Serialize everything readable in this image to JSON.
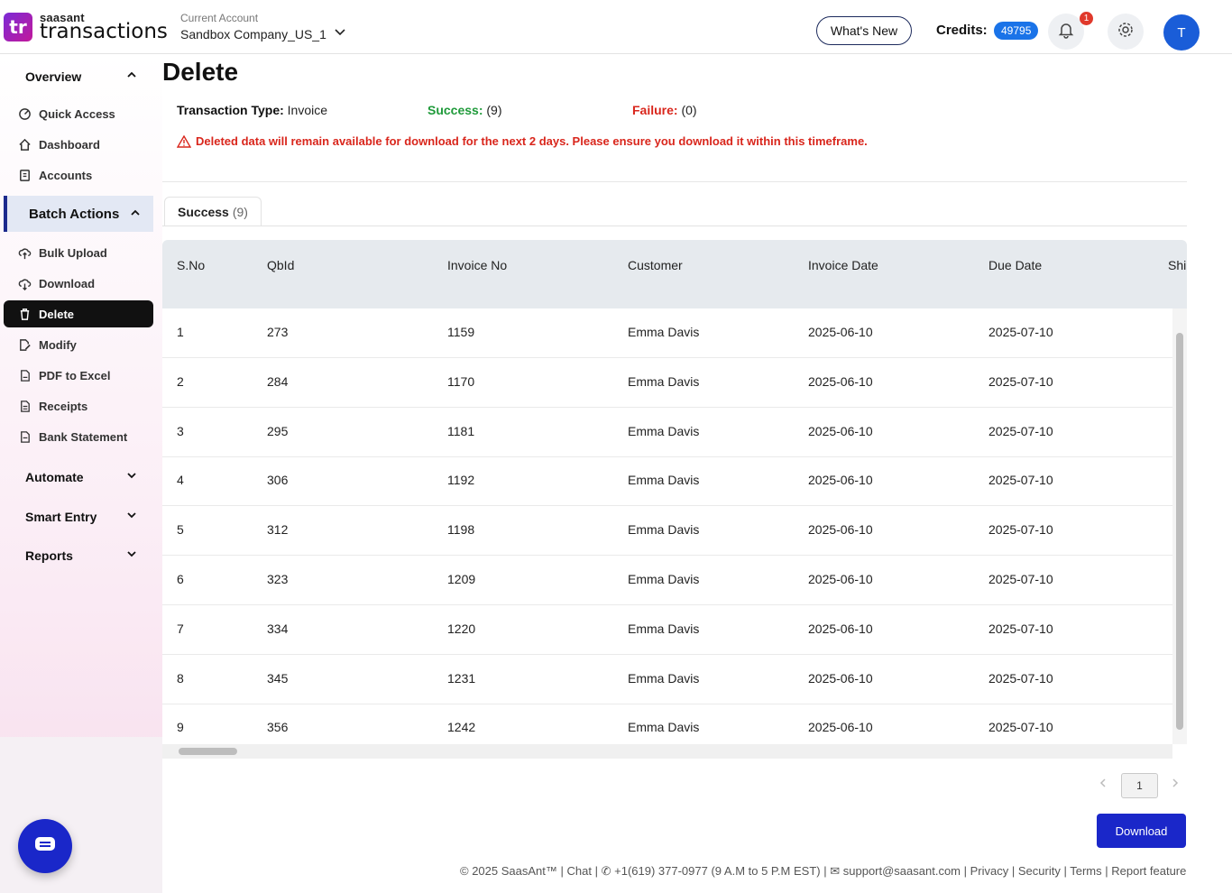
{
  "brand": {
    "logo_letters": "tr",
    "small": "saasant",
    "big": "transactions"
  },
  "account": {
    "label": "Current Account",
    "name": "Sandbox Company_US_1"
  },
  "header": {
    "whats_new": "What's New",
    "credits_label": "Credits:",
    "credits_value": "49795",
    "notif_count": "1",
    "avatar_initial": "T"
  },
  "sidebar": {
    "overview": "Overview",
    "overview_items": [
      "Quick Access",
      "Dashboard",
      "Accounts"
    ],
    "batch_actions": "Batch Actions",
    "batch_items": [
      "Bulk Upload",
      "Download",
      "Delete",
      "Modify",
      "PDF to Excel",
      "Receipts",
      "Bank Statement"
    ],
    "automate": "Automate",
    "smart_entry": "Smart Entry",
    "reports": "Reports"
  },
  "page": {
    "title": "Delete",
    "type_label": "Transaction Type:",
    "type_value": "Invoice",
    "success_label": "Success:",
    "success_value": "(9)",
    "failure_label": "Failure:",
    "failure_value": "(0)",
    "warning": "Deleted data will remain available for download for the next 2 days. Please ensure you download it within this timeframe.",
    "tab_label": "Success",
    "tab_count": "(9)"
  },
  "table": {
    "columns": [
      "S.No",
      "QbId",
      "Invoice No",
      "Customer",
      "Invoice Date",
      "Due Date",
      "Shi"
    ],
    "rows": [
      [
        "1",
        "273",
        "1159",
        "Emma Davis",
        "2025-06-10",
        "2025-07-10"
      ],
      [
        "2",
        "284",
        "1170",
        "Emma Davis",
        "2025-06-10",
        "2025-07-10"
      ],
      [
        "3",
        "295",
        "1181",
        "Emma Davis",
        "2025-06-10",
        "2025-07-10"
      ],
      [
        "4",
        "306",
        "1192",
        "Emma Davis",
        "2025-06-10",
        "2025-07-10"
      ],
      [
        "5",
        "312",
        "1198",
        "Emma Davis",
        "2025-06-10",
        "2025-07-10"
      ],
      [
        "6",
        "323",
        "1209",
        "Emma Davis",
        "2025-06-10",
        "2025-07-10"
      ],
      [
        "7",
        "334",
        "1220",
        "Emma Davis",
        "2025-06-10",
        "2025-07-10"
      ],
      [
        "8",
        "345",
        "1231",
        "Emma Davis",
        "2025-06-10",
        "2025-07-10"
      ],
      [
        "9",
        "356",
        "1242",
        "Emma Davis",
        "2025-06-10",
        "2025-07-10"
      ]
    ]
  },
  "pagination": {
    "current": "1"
  },
  "download_label": "Download",
  "footer": {
    "copyright": "© 2025 SaasAnt™",
    "chat": "Chat",
    "phone": "+1(619) 377-0977 (9 A.M to 5 P.M EST)",
    "email": "support@saasant.com",
    "privacy": "Privacy",
    "security": "Security",
    "terms": "Terms",
    "report": "Report feature"
  }
}
